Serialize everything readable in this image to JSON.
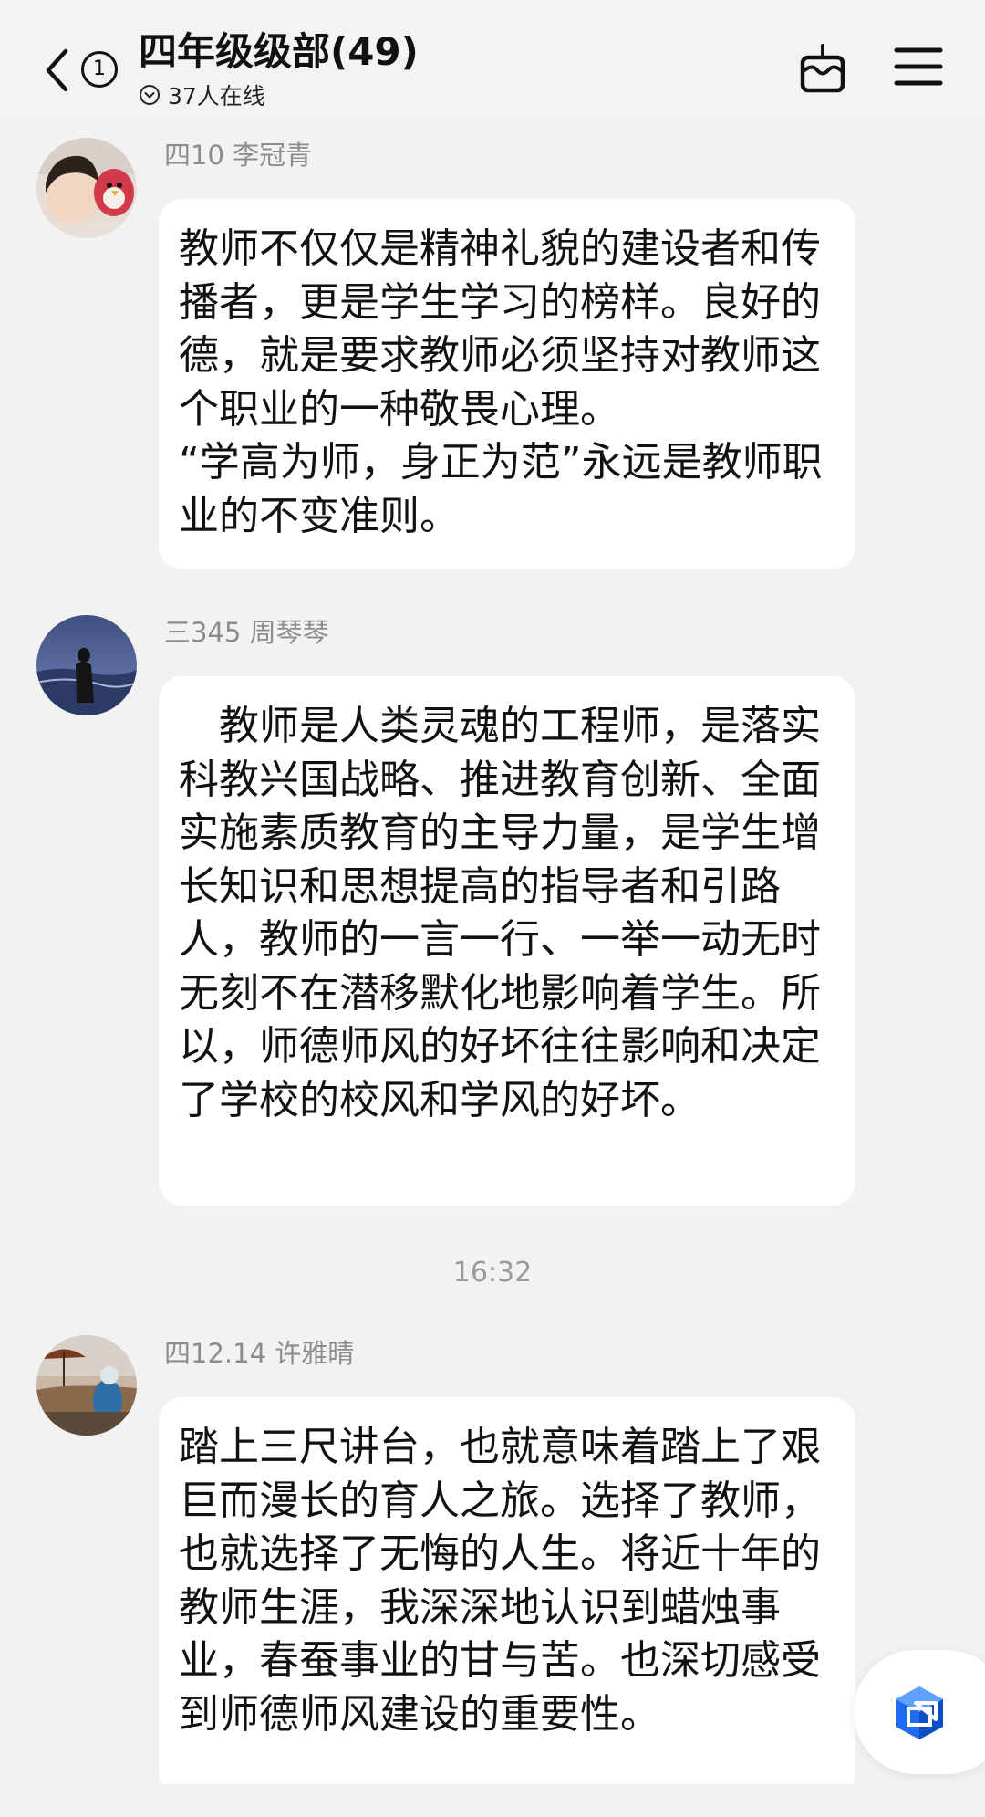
{
  "header": {
    "back_icon": "chevron-left-icon",
    "unread_count": "1",
    "title": "四年级级部(49)",
    "online_icon": "chevron-down-circle-icon",
    "online_text": "37人在线",
    "cake_icon": "birthday-cake-icon",
    "menu_icon": "hamburger-menu-icon"
  },
  "messages": [
    {
      "sender": "四10 李冠青",
      "avatar": "child-with-plush-toy-photo",
      "text": "教师不仅仅是精神礼貌的建设者和传播者，更是学生学习的榜样。良好的德，就是要求教师必须坚持对教师这个职业的一种敬畏心理。\n“学高为师，身正为范”永远是教师职业的不变准则。"
    },
    {
      "sender": "三345 周琴琴",
      "avatar": "person-by-sea-photo",
      "text": "　教师是人类灵魂的工程师，是落实科教兴国战略、推进教育创新、全面实施素质教育的主导力量，是学生增长知识和思想提高的指导者和引路人，教师的一言一行、一举一动无时无刻不在潜移默化地影响着学生。所以，师德师风的好坏往往影响和决定了学校的校风和学风的好坏。"
    },
    {
      "sender": "四12.14 许雅晴",
      "avatar": "beach-umbrella-photo",
      "text": "踏上三尺讲台，也就意味着踏上了艰巨而漫长的育人之旅。选择了教师，也就选择了无悔的人生。将近十年的教师生涯，我深深地认识到蜡烛事业，春蚕事业的甘与苦。也深切感受到师德师风建设的重要性。"
    }
  ],
  "timestamp": "16:32",
  "fab_icon": "stacked-cube-icon",
  "colors": {
    "background": "#f2f2f2",
    "bubble": "#ffffff",
    "sender_text": "#8c8c8c",
    "fab_blue": "#1e6cf0"
  }
}
